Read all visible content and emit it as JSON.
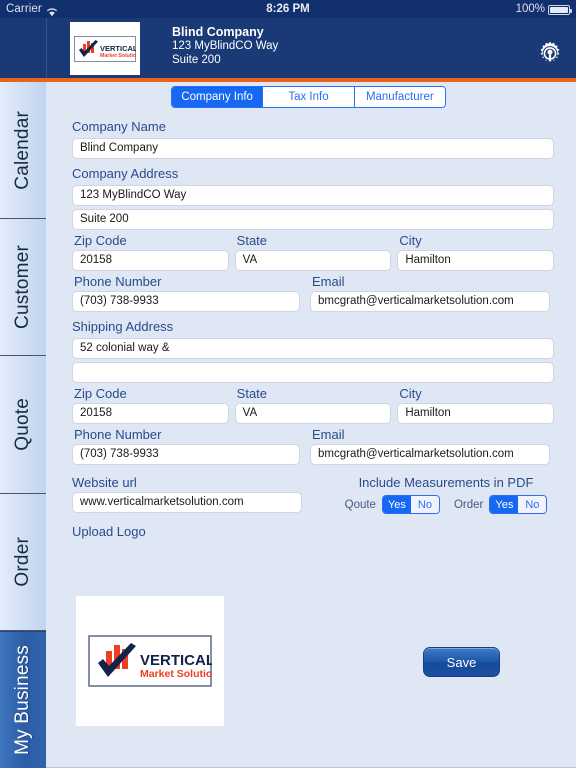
{
  "statusbar": {
    "carrier": "Carrier",
    "wifi_icon": "wifi-icon",
    "time": "8:26 PM",
    "battery_percent": "100%",
    "battery_icon": "battery-full-icon"
  },
  "header": {
    "logo_alt": "Vertical Market Solution",
    "company": "Blind Company",
    "address_line1": "123 MyBlindCO Way",
    "address_line2": "Suite 200",
    "settings_icon": "gear-icon"
  },
  "sidebar": {
    "items": [
      {
        "label": "Calendar",
        "selected": false
      },
      {
        "label": "Customer",
        "selected": false
      },
      {
        "label": "Quote",
        "selected": false
      },
      {
        "label": "Order",
        "selected": false
      },
      {
        "label": "My Business",
        "selected": true
      }
    ]
  },
  "tabs": [
    {
      "label": "Company Info",
      "active": true
    },
    {
      "label": "Tax Info",
      "active": false
    },
    {
      "label": "Manufacturer",
      "active": false
    }
  ],
  "form": {
    "company_name_label": "Company Name",
    "company_name_value": "Blind Company",
    "company_address_label": "Company Address",
    "company_address_line1": "123 MyBlindCO Way",
    "company_address_line2": "Suite 200",
    "billing": {
      "zip_label": "Zip Code",
      "zip_value": "20158",
      "state_label": "State",
      "state_value": "VA",
      "city_label": "City",
      "city_value": "Hamilton",
      "phone_label": "Phone Number",
      "phone_value": "(703) 738-9933",
      "email_label": "Email",
      "email_value": "bmcgrath@verticalmarketsolution.com"
    },
    "shipping_label": "Shipping Address",
    "shipping": {
      "line1": "52 colonial way &",
      "line2": "",
      "zip_label": "Zip Code",
      "zip_value": "20158",
      "state_label": "State",
      "state_value": "VA",
      "city_label": "City",
      "city_value": "Hamilton",
      "phone_label": "Phone Number",
      "phone_value": "(703) 738-9933",
      "email_label": "Email",
      "email_value": "bmcgrath@verticalmarketsolution.com"
    },
    "website_label": "Website url",
    "website_value": "www.verticalmarketsolution.com",
    "measurements_title": "Include Measurements in PDF",
    "quote_toggle_label": "Qoute",
    "quote_yes": "Yes",
    "quote_no": "No",
    "quote_selected": "Yes",
    "order_toggle_label": "Order",
    "order_yes": "Yes",
    "order_no": "No",
    "order_selected": "Yes",
    "upload_logo_label": "Upload Logo",
    "logo_alt": "Vertical Market Solution",
    "save_label": "Save"
  },
  "colors": {
    "header_blue": "#1a3a77",
    "status_blue": "#12306d",
    "accent_orange": "#e8641c",
    "tab_blue": "#1667f2",
    "content_bg": "#dfe7f5",
    "label_blue": "#2a4a8c",
    "logo_red": "#ef3e23",
    "logo_navy": "#12224a"
  }
}
